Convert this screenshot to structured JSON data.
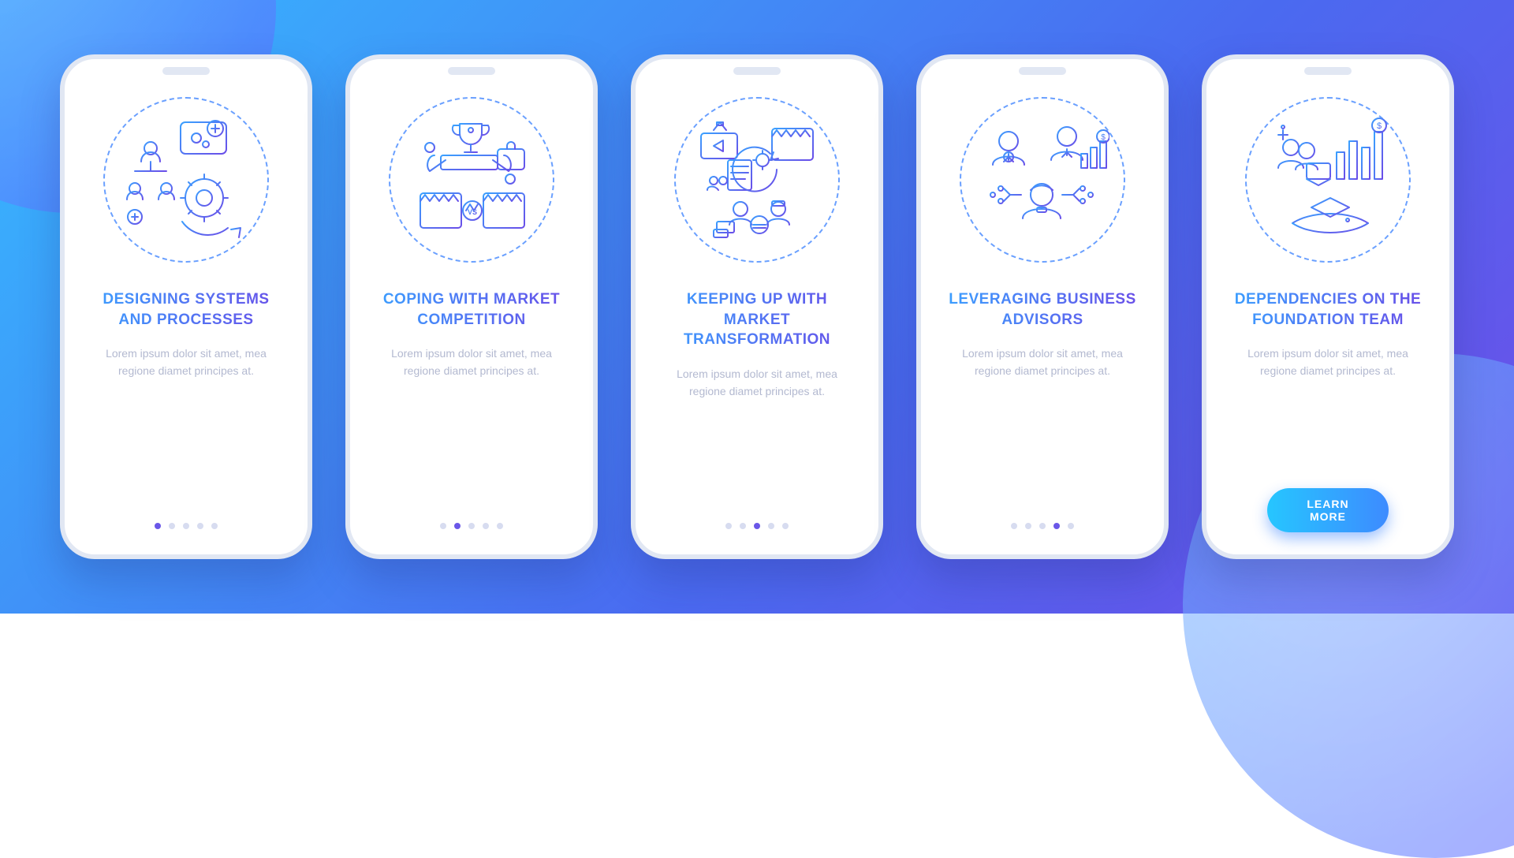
{
  "body_text": "Lorem ipsum dolor sit amet, mea regione diamet principes at.",
  "cta_label": "LEARN MORE",
  "colors": {
    "grad_start": "#3aa0ff",
    "grad_end": "#6a4de8",
    "cta_start": "#26c6ff",
    "cta_end": "#3d8bff"
  },
  "screens": [
    {
      "title": "DESIGNING SYSTEMS AND PROCESSES",
      "icon": "systems-icon",
      "active_dot": 0
    },
    {
      "title": "COPING WITH MARKET COMPETITION",
      "icon": "competition-icon",
      "active_dot": 1
    },
    {
      "title": "KEEPING UP WITH MARKET TRANSFORMATION",
      "icon": "transformation-icon",
      "active_dot": 2
    },
    {
      "title": "LEVERAGING BUSINESS ADVISORS",
      "icon": "advisors-icon",
      "active_dot": 3
    },
    {
      "title": "DEPENDENCIES ON THE FOUNDATION TEAM",
      "icon": "foundation-icon",
      "active_dot": 4
    }
  ]
}
